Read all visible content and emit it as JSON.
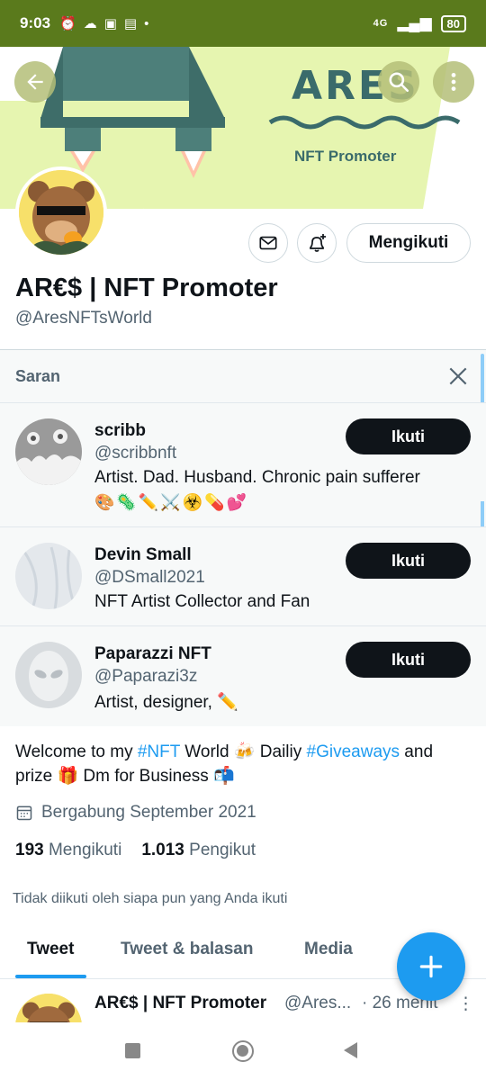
{
  "status_bar": {
    "time": "9:03",
    "network": "4G",
    "battery": "80"
  },
  "banner": {
    "logo_text": "ARES",
    "tagline": "NFT Promoter"
  },
  "profile": {
    "name": "AR€$ | NFT Promoter",
    "handle": "@AresNFTsWorld",
    "following_button": "Mengikuti",
    "bio_parts": {
      "p1": "Welcome to my ",
      "tag1": "#NFT",
      "p2": " World 🍻 Dailiy ",
      "tag2": "#Giveaways",
      "p3": " and prize 🎁  Dm for Business 📬"
    },
    "joined": "Bergabung September 2021",
    "following_count": "193",
    "following_label": "Mengikuti",
    "followers_count": "1.013",
    "followers_label": "Pengikut",
    "not_followed_text": "Tidak diikuti oleh siapa pun yang Anda ikuti"
  },
  "suggestions": {
    "title": "Saran",
    "follow_label": "Ikuti",
    "items": [
      {
        "name": "scribb",
        "handle": "@scribbnft",
        "bio": "Artist. Dad. Husband. Chronic pain sufferer",
        "emoji": "🎨🦠✏️⚔️☣️💊💕"
      },
      {
        "name": "Devin Small",
        "handle": "@DSmall2021",
        "bio": "NFT Artist Collector and Fan"
      },
      {
        "name": "Paparazzi NFT",
        "handle": "@Paparazi3z",
        "bio": "Artist, designer, ✏️"
      }
    ]
  },
  "tabs": [
    "Tweet",
    "Tweet & balasan",
    "Media"
  ],
  "tweet": {
    "name": "AR€$ | NFT Promoter",
    "handle": "@Ares...",
    "time": "· 26 menit",
    "more": "⋮"
  },
  "colors": {
    "accent": "#1d9bf0",
    "status_bar": "#5a7a1c",
    "banner_teal": "#3a6b6b",
    "banner_lime": "#e6f5b0"
  }
}
